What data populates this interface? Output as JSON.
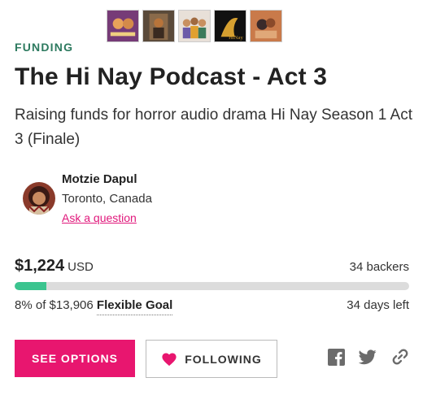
{
  "thumbnails": [
    {
      "name": "thumbnail-1",
      "bg": "#4b2b6e",
      "accent": "#e8a25a"
    },
    {
      "name": "thumbnail-2",
      "bg": "#5a4a3a",
      "accent": "#b8743a"
    },
    {
      "name": "thumbnail-3",
      "bg": "#e8e0d8",
      "accent": "#6b5aa8"
    },
    {
      "name": "thumbnail-4",
      "bg": "#111111",
      "accent": "#d6a030"
    },
    {
      "name": "thumbnail-5",
      "bg": "#c97a4a",
      "accent": "#3a2a2a"
    }
  ],
  "campaign": {
    "category": "FUNDING",
    "title": "The Hi Nay Podcast - Act 3",
    "blurb": "Raising funds for horror audio drama Hi Nay Season 1 Act 3 (Finale)"
  },
  "creator": {
    "name": "Motzie Dapul",
    "location": "Toronto, Canada",
    "ask_link": "Ask a question"
  },
  "stats": {
    "raised": "$1,224",
    "currency": "USD",
    "backers": "34 backers",
    "percent_text": "8% of $13,906",
    "goal_type": "Flexible Goal",
    "days_left": "34 days left",
    "progress_fraction": 0.08
  },
  "actions": {
    "options_label": "SEE OPTIONS",
    "follow_label": "FOLLOWING"
  },
  "share": {
    "facebook_icon": "facebook-icon",
    "twitter_icon": "twitter-icon",
    "link_icon": "link-icon"
  },
  "colors": {
    "accent": "#e8166f",
    "category": "#2d7a5f",
    "progress": "#3bc48f",
    "share_icon": "#6b6b6b"
  }
}
